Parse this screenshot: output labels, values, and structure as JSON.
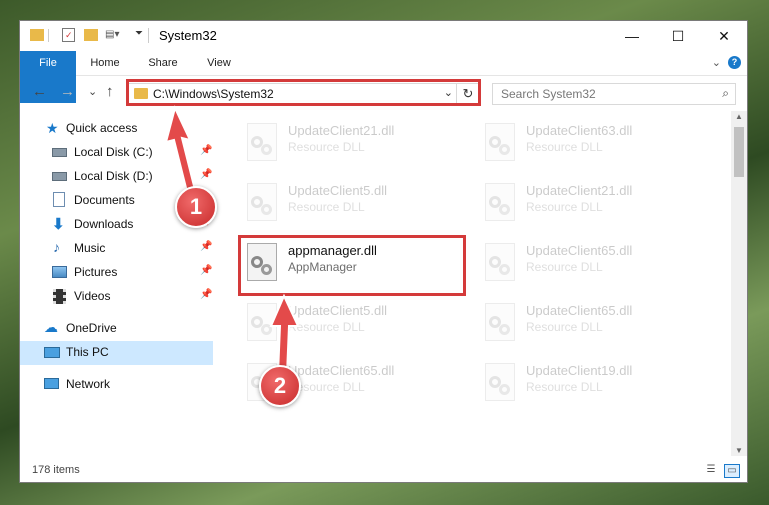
{
  "window": {
    "title": "System32",
    "minimize": "—",
    "maximize": "☐",
    "close": "✕"
  },
  "ribbon": {
    "tabs": [
      "File",
      "Home",
      "Share",
      "View"
    ],
    "collapse_glyph": "⌄",
    "help_glyph": "?"
  },
  "nav": {
    "back": "←",
    "forward": "→",
    "recent": "⌄",
    "up": "↑"
  },
  "address": {
    "path": "C:\\Windows\\System32",
    "dropdown": "⌄",
    "refresh": "↻"
  },
  "search": {
    "placeholder": "Search System32",
    "icon": "⌕"
  },
  "sidebar": {
    "items": [
      {
        "label": "Quick access",
        "icon": "star-icon"
      },
      {
        "label": "Local Disk (C:)",
        "icon": "drive-icon",
        "pinned": true
      },
      {
        "label": "Local Disk (D:)",
        "icon": "drive-icon",
        "pinned": true
      },
      {
        "label": "Documents",
        "icon": "documents-icon",
        "pinned": true
      },
      {
        "label": "Downloads",
        "icon": "download-icon",
        "pinned": true
      },
      {
        "label": "Music",
        "icon": "music-icon",
        "pinned": true
      },
      {
        "label": "Pictures",
        "icon": "pictures-icon",
        "pinned": true
      },
      {
        "label": "Videos",
        "icon": "videos-icon",
        "pinned": true
      },
      {
        "label": "OneDrive",
        "icon": "cloud-icon"
      },
      {
        "label": "This PC",
        "icon": "computer-icon",
        "selected": true
      },
      {
        "label": "Network",
        "icon": "network-icon"
      }
    ],
    "pin_glyph": "📌"
  },
  "files": [
    {
      "name": "UpdateClient21.dll",
      "desc": "Resource DLL"
    },
    {
      "name": "UpdateClient63.dll",
      "desc": "Resource DLL"
    },
    {
      "name": "UpdateClient5.dll",
      "desc": "Resource DLL"
    },
    {
      "name": "UpdateClient21.dll",
      "desc": "Resource DLL"
    },
    {
      "name": "appmanager.dll",
      "desc": "AppManager"
    },
    {
      "name": "UpdateClient65.dll",
      "desc": "Resource DLL"
    },
    {
      "name": "UpdateClient5.dll",
      "desc": "Resource DLL"
    },
    {
      "name": "UpdateClient65.dll",
      "desc": "Resource DLL"
    },
    {
      "name": "UpdateClient65.dll",
      "desc": "Resource DLL"
    },
    {
      "name": "UpdateClient19.dll",
      "desc": "Resource DLL"
    }
  ],
  "status": {
    "count": "178 items"
  },
  "annotations": {
    "step1": "1",
    "step2": "2",
    "highlight_color": "#d43a3a"
  },
  "colors": {
    "accent": "#1979ca",
    "selected": "#cde8ff"
  }
}
